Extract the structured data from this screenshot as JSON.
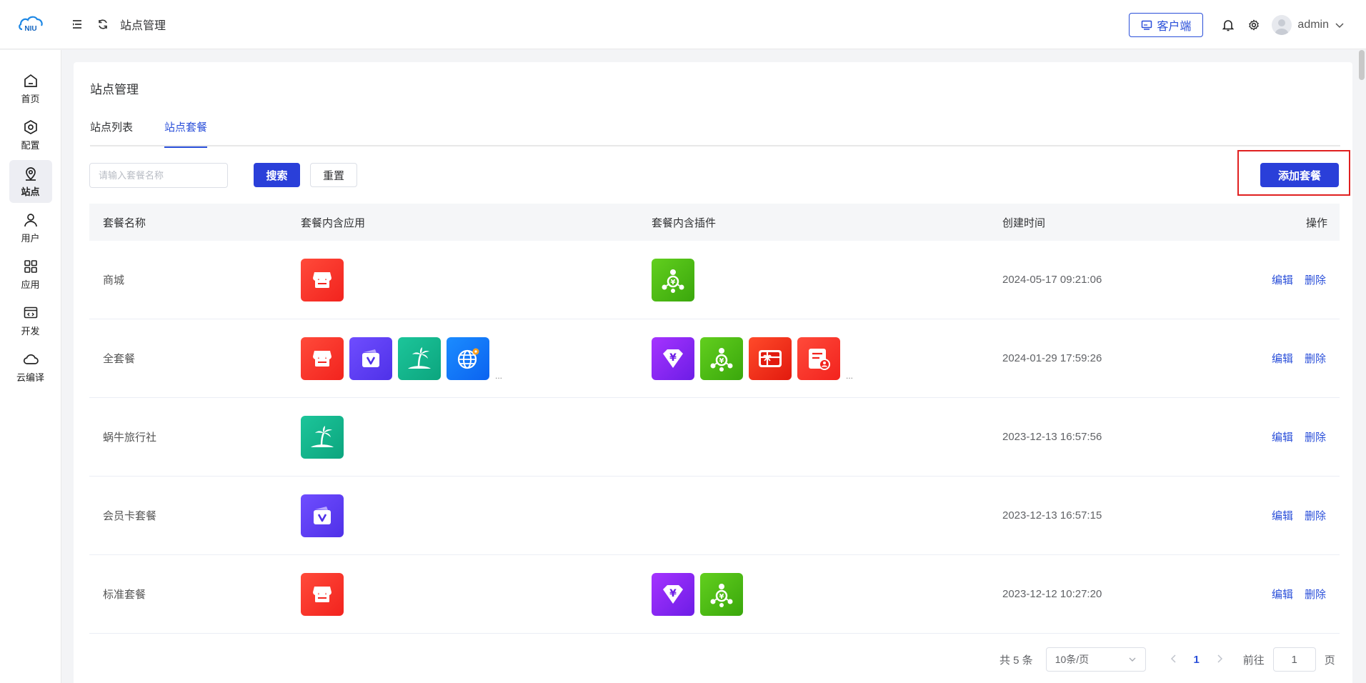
{
  "header": {
    "logo_text": "NIU",
    "breadcrumb": "站点管理",
    "client_label": "客户端",
    "username": "admin"
  },
  "sidebar": {
    "items": [
      {
        "label": "首页",
        "icon": "home-icon"
      },
      {
        "label": "配置",
        "icon": "settings-hex-icon"
      },
      {
        "label": "站点",
        "icon": "location-icon"
      },
      {
        "label": "用户",
        "icon": "user-icon"
      },
      {
        "label": "应用",
        "icon": "apps-grid-icon"
      },
      {
        "label": "开发",
        "icon": "code-window-icon"
      },
      {
        "label": "云编译",
        "icon": "cloud-icon"
      }
    ],
    "active_index": 2
  },
  "page": {
    "title": "站点管理",
    "tabs": [
      {
        "label": "站点列表",
        "active": false
      },
      {
        "label": "站点套餐",
        "active": true
      }
    ],
    "search_placeholder": "请输入套餐名称",
    "search_label": "搜索",
    "reset_label": "重置",
    "add_label": "添加套餐"
  },
  "table": {
    "columns": [
      "套餐名称",
      "套餐内含应用",
      "套餐内含插件",
      "创建时间",
      "操作"
    ],
    "edit_label": "编辑",
    "delete_label": "删除",
    "more_text": "...",
    "rows": [
      {
        "name": "商城",
        "apps": [
          "shop-app-icon"
        ],
        "plugins": [
          "distribution-plugin-icon"
        ],
        "created": "2024-05-17 09:21:06"
      },
      {
        "name": "全套餐",
        "apps": [
          "shop-app-icon",
          "vip-card-app-icon",
          "travel-app-icon",
          "website-app-icon"
        ],
        "apps_more": true,
        "plugins": [
          "diamond-yuan-plugin-icon",
          "distribution-plugin-icon",
          "gift-card-plugin-icon",
          "resume-plugin-icon"
        ],
        "plugins_more": true,
        "created": "2024-01-29 17:59:26"
      },
      {
        "name": "蜗牛旅行社",
        "apps": [
          "travel-app-icon"
        ],
        "plugins": [],
        "created": "2023-12-13 16:57:56"
      },
      {
        "name": "会员卡套餐",
        "apps": [
          "vip-card-app-icon"
        ],
        "plugins": [],
        "created": "2023-12-13 16:57:15"
      },
      {
        "name": "标准套餐",
        "apps": [
          "shop-app-icon"
        ],
        "plugins": [
          "diamond-yuan-plugin-icon",
          "distribution-plugin-icon"
        ],
        "created": "2023-12-12 10:27:20"
      }
    ]
  },
  "pagination": {
    "total_text": "共 5 条",
    "page_size": "10条/页",
    "current_page": "1",
    "goto_prefix": "前往",
    "goto_value": "1",
    "goto_suffix": "页"
  },
  "colors": {
    "primary": "#2a3fd9",
    "highlight": "#e02020"
  }
}
